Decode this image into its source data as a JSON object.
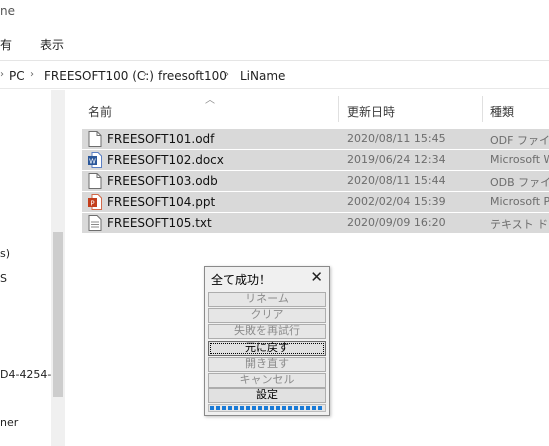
{
  "window": {
    "title_fragment": "ne"
  },
  "ribbon": {
    "tabs": [
      "有",
      "表示"
    ]
  },
  "address": {
    "segments": [
      "PC",
      "FREESOFT100 (C:)",
      "freesoft100",
      "LiName"
    ]
  },
  "nav": {
    "items": [
      "s)",
      "S",
      "D4-4254-..",
      "ner"
    ]
  },
  "columns": {
    "name": "名前",
    "modified": "更新日時",
    "type": "種類"
  },
  "files": [
    {
      "name": "FREESOFT101.odf",
      "date": "2020/08/11 15:45",
      "type": "ODF ファイル",
      "icon": "generic-file-icon"
    },
    {
      "name": "FREESOFT102.docx",
      "date": "2019/06/24 12:34",
      "type": "Microsoft W",
      "icon": "word-doc-icon"
    },
    {
      "name": "FREESOFT103.odb",
      "date": "2020/08/11 15:44",
      "type": "ODB ファイル",
      "icon": "generic-file-icon"
    },
    {
      "name": "FREESOFT104.ppt",
      "date": "2002/02/04 15:39",
      "type": "Microsoft P",
      "icon": "powerpoint-icon"
    },
    {
      "name": "FREESOFT105.txt",
      "date": "2020/09/09 16:20",
      "type": "テキスト ドキ",
      "icon": "text-file-icon"
    }
  ],
  "dialog": {
    "title": "全て成功！",
    "buttons": {
      "rename": "リネーム",
      "clear": "クリア",
      "retry_failed": "失敗を再試行",
      "undo": "元に戻す",
      "reopen": "開き直す",
      "cancel": "キャンセル",
      "settings": "設定"
    },
    "progress": 1.0
  },
  "colors": {
    "selection": "#d9d9d9",
    "progress": "#1a7ad6"
  }
}
